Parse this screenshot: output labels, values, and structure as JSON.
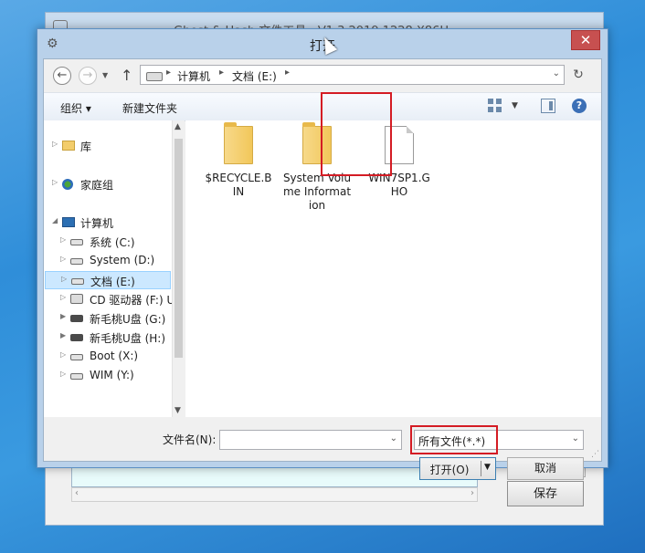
{
  "background_window": {
    "title": "Ghost & Hash 文件工具 · V1.3.2019.1228 X86H",
    "save_label": "保存"
  },
  "dialog": {
    "title": "打开",
    "close_glyph": "✕"
  },
  "address": {
    "crumbs": [
      "计算机",
      "文档 (E:)"
    ]
  },
  "toolbar": {
    "organize_label": "组织 ▾",
    "new_folder_label": "新建文件夹",
    "help_glyph": "?"
  },
  "nav_tree": {
    "items": [
      {
        "label": "库"
      },
      {
        "label": "家庭组"
      },
      {
        "label": "计算机"
      },
      {
        "label": "系统 (C:)"
      },
      {
        "label": "System (D:)"
      },
      {
        "label": "文档 (E:)"
      },
      {
        "label": "CD 驱动器 (F:) U"
      },
      {
        "label": "新毛桃U盘 (G:)"
      },
      {
        "label": "新毛桃U盘 (H:)"
      },
      {
        "label": "Boot (X:)"
      },
      {
        "label": "WIM (Y:)"
      }
    ]
  },
  "files": [
    {
      "name": "$RECYCLE.BIN",
      "type": "folder"
    },
    {
      "name": "System Volume Information",
      "type": "folder"
    },
    {
      "name": "WIN7SP1.GHO",
      "type": "file"
    }
  ],
  "footer": {
    "filename_label": "文件名(N):",
    "filename_value": "",
    "filetype_value": "所有文件(*.*)",
    "open_label": "打开(O)",
    "cancel_label": "取消"
  },
  "colors": {
    "highlight": "#d41c24",
    "selection": "#cce8ff",
    "accent": "#3c7fb1"
  },
  "icons": [
    "back-icon",
    "forward-icon",
    "up-icon",
    "refresh-icon",
    "drive-icon",
    "folder-icon",
    "file-icon",
    "view-icon",
    "preview-pane-icon",
    "help-icon",
    "close-icon"
  ]
}
